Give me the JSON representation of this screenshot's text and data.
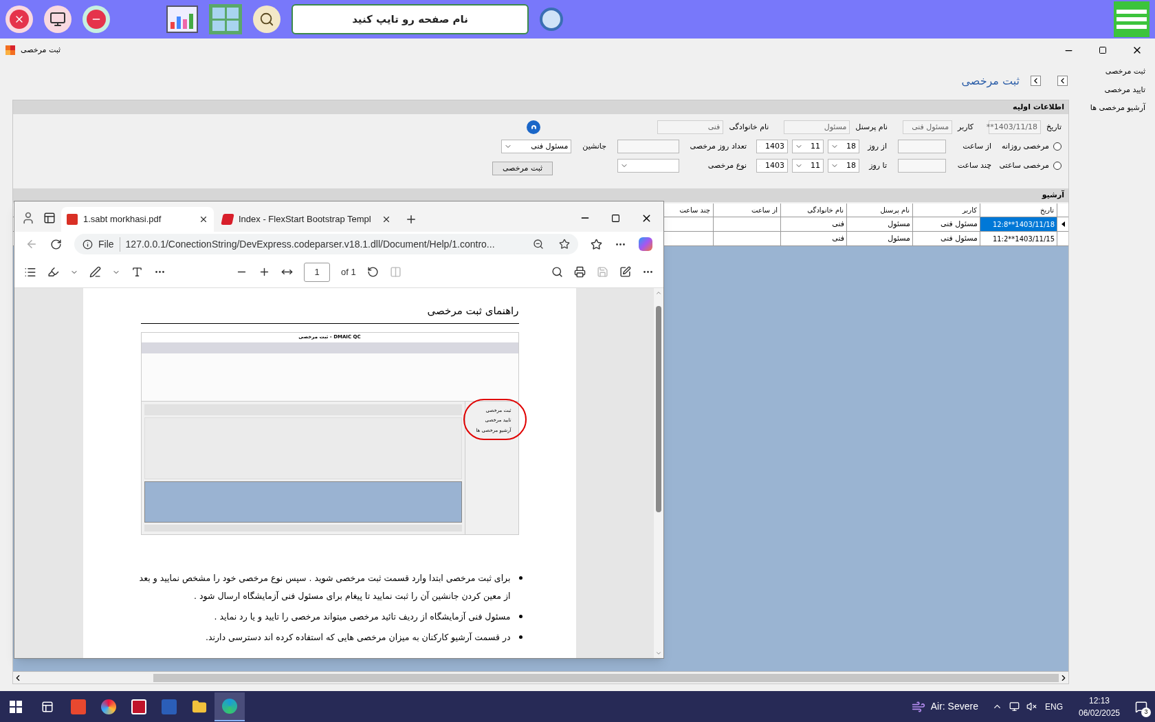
{
  "top_bar": {
    "search": {
      "placeholder": "نام صفحه رو تایپ کنید"
    }
  },
  "window": {
    "title": "ثبت مرخصی"
  },
  "side_menu": [
    {
      "label": "ثبت مرخصی"
    },
    {
      "label": "تایید مرخصی"
    },
    {
      "label": "آرشیو مرخصی ها"
    }
  ],
  "page_title": "ثبت مرخصی",
  "info": {
    "title": "اطلاعات اولیه",
    "fields": [
      {
        "label": "تاریخ",
        "value": "1403/11/18**"
      },
      {
        "label": "کاربر",
        "value": "مسئول فنی"
      },
      {
        "label": "نام پرسنل",
        "value": "مسئول"
      },
      {
        "label": "نام خانوادگی",
        "value": "فنی"
      }
    ]
  },
  "leave_rows": [
    {
      "radio": {
        "label": "مرخصی روزانه",
        "selected": false
      },
      "time_label": "از ساعت",
      "day_label": "از روز",
      "day": "18",
      "month": "11",
      "year": "1403",
      "field_label": "تعداد روز مرخصی",
      "kind": "input"
    },
    {
      "radio": {
        "label": "مرخصی ساعتی",
        "selected": false
      },
      "time_label": "چند ساعت",
      "day_label": "تا روز",
      "day": "18",
      "month": "11",
      "year": "1403",
      "field_label": "نوع مرخصی",
      "kind": "select"
    }
  ],
  "substitute": {
    "label": "جانشین",
    "value": "مسئول فنی"
  },
  "submit_button": "ثبت مرخصی",
  "archive": {
    "title": "آرشیو",
    "columns": [
      "تاریخ",
      "کاربر",
      "نام پرسنل",
      "نام خانوادگی",
      "از ساعت",
      "چند ساعت"
    ],
    "rows": [
      {
        "selected": true,
        "cells": [
          "1403/11/18**12:8",
          "مسئول فنی",
          "مسئول",
          "فنی"
        ]
      },
      {
        "selected": false,
        "cells": [
          "1403/11/15**11:2",
          "مسئول فنی",
          "مسئول",
          "فنی"
        ]
      }
    ]
  },
  "browser": {
    "active_tab": {
      "title": "1.sabt morkhasi.pdf",
      "kind": "pdf",
      "selected": true
    },
    "background_tab": {
      "title": "Index - FlexStart Bootstrap Templ",
      "kind": "web",
      "selected": false
    },
    "address": {
      "label": "File",
      "url": "127.0.0.1/ConectionString/DevExpress.codeparser.v18.1.dll/Document/Help/1.contro..."
    },
    "pdf_toolbar": {
      "page": "1",
      "page_count": "of 1"
    },
    "document": {
      "title": "راهنمای ثبت مرخصی",
      "screenshot": {
        "title": "DMAIC QC - ثبت مرخصی",
        "menu": [
          "ثبت مرخصی",
          "تایید مرخصی",
          "آرشیو مرخصی ها"
        ]
      },
      "bullets": [
        "برای ثبت مرخصی ابتدا وارد قسمت ثبت مرخصی شوید . سپس نوع مرخصی خود را مشخص نمایید و بعد از معین کردن جانشین آن را ثبت نمایید تا پیغام برای مسئول فنی آزمایشگاه ارسال شود .",
        "مسئول فنی آزمایشگاه از ردیف تائید مرخصی میتواند مرخصی را تایید و یا رد نماید .",
        "در قسمت آرشیو کارکنان به میزان مرخصی هایی که استفاده کرده اند دسترسی دارند."
      ]
    }
  },
  "taskbar": {
    "apps": [
      {
        "kind": "s",
        "selected": false
      },
      {
        "kind": "fan",
        "selected": false
      },
      {
        "kind": "d",
        "selected": false
      },
      {
        "kind": "word",
        "selected": false
      },
      {
        "kind": "folder",
        "selected": false
      },
      {
        "kind": "edge",
        "selected": true
      }
    ],
    "weather": "Air: Severe",
    "language": "ENG",
    "time": "12:13",
    "date": "06/02/2025",
    "notifications": "3"
  }
}
